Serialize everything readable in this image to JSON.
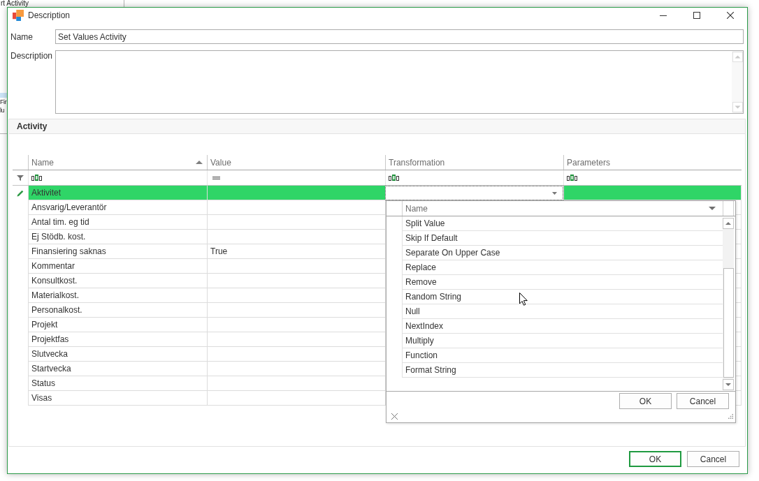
{
  "background_window": {
    "title": "rt Activity",
    "texts": [
      "Fir",
      "lu"
    ]
  },
  "window": {
    "title": "Description"
  },
  "form": {
    "name_label": "Name",
    "name_value": "Set Values Activity",
    "description_label": "Description"
  },
  "activity": {
    "title": "Activity",
    "columns": [
      {
        "label": "Name",
        "sorted": true,
        "focused": false
      },
      {
        "label": "Value",
        "sorted": false,
        "focused": false
      },
      {
        "label": "Transformation",
        "sorted": false,
        "focused": true
      },
      {
        "label": "Parameters",
        "sorted": false,
        "focused": false
      }
    ],
    "filter_row": [
      {
        "kind": "text"
      },
      {
        "kind": "equals"
      },
      {
        "kind": "text"
      },
      {
        "kind": "text"
      }
    ],
    "rows": [
      {
        "name": "Aktivitet",
        "selected": true
      },
      {
        "name": "Ansvarig/Leverantör",
        "selected": false
      },
      {
        "name": "Antal tim. eg tid",
        "selected": false
      },
      {
        "name": "Ej Stödb. kost.",
        "selected": false
      },
      {
        "name": "Finansiering saknas",
        "value": "True",
        "selected": false
      },
      {
        "name": "Kommentar",
        "selected": false
      },
      {
        "name": "Konsultkost.",
        "selected": false
      },
      {
        "name": "Materialkost.",
        "selected": false
      },
      {
        "name": "Personalkost.",
        "selected": false
      },
      {
        "name": "Projekt",
        "selected": false
      },
      {
        "name": "Projektfas",
        "selected": false
      },
      {
        "name": "Slutvecka",
        "selected": false
      },
      {
        "name": "Startvecka",
        "selected": false
      },
      {
        "name": "Status",
        "selected": false
      },
      {
        "name": "Visas",
        "selected": false
      }
    ],
    "dropdown": {
      "open": true,
      "column": "Name",
      "items": [
        {
          "label": "Split Value",
          "selected": false
        },
        {
          "label": "Skip If Default",
          "selected": false
        },
        {
          "label": "Separate On Upper Case",
          "selected": false
        },
        {
          "label": "Replace",
          "selected": false
        },
        {
          "label": "Remove",
          "selected": false
        },
        {
          "label": "Random String",
          "selected": false
        },
        {
          "label": "Null",
          "selected": false
        },
        {
          "label": "NextIndex",
          "selected": false
        },
        {
          "label": "Multiply",
          "selected": false
        },
        {
          "label": "Function",
          "selected": false
        },
        {
          "label": "Format String",
          "selected": false
        }
      ],
      "buttons": [
        "OK",
        "Cancel"
      ]
    }
  },
  "buttons": [
    {
      "label": "OK",
      "default": true
    },
    {
      "label": "Cancel",
      "default": false
    }
  ]
}
